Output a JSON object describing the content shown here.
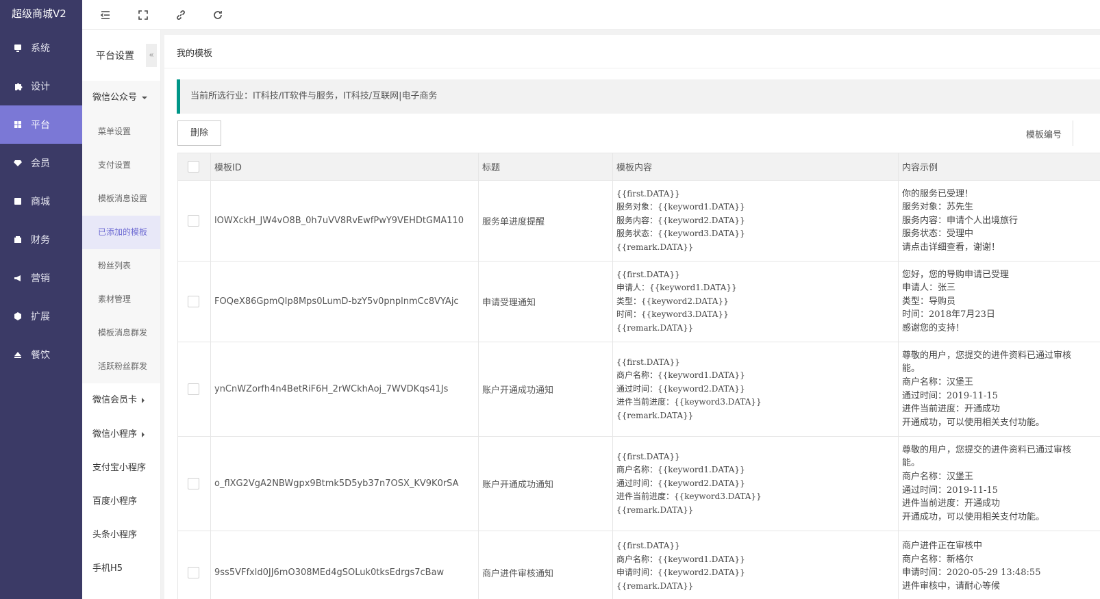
{
  "app": {
    "brand": "超级商城V2"
  },
  "nav": [
    {
      "label": "系统",
      "icon": "monitor-icon"
    },
    {
      "label": "设计",
      "icon": "puzzle-icon"
    },
    {
      "label": "平台",
      "icon": "grid-icon"
    },
    {
      "label": "会员",
      "icon": "diamond-icon"
    },
    {
      "label": "商城",
      "icon": "mail-icon"
    },
    {
      "label": "财务",
      "icon": "wallet-icon"
    },
    {
      "label": "营销",
      "icon": "megaphone-icon"
    },
    {
      "label": "扩展",
      "icon": "cube-icon"
    },
    {
      "label": "餐饮",
      "icon": "eject-icon"
    }
  ],
  "topbar": {
    "icons": [
      "menu-collapse-icon",
      "fullscreen-icon",
      "link-icon",
      "refresh-icon"
    ]
  },
  "subnav": {
    "title": "平台设置",
    "collapse": "«",
    "group_wechat": "微信公众号",
    "wechat_items": [
      "菜单设置",
      "支付设置",
      "模板消息设置",
      "已添加的模板",
      "粉丝列表",
      "素材管理",
      "模板消息群发",
      "活跃粉丝群发"
    ],
    "group_card": "微信会员卡",
    "group_mini": "微信小程序",
    "plain": [
      "支付宝小程序",
      "百度小程序",
      "头条小程序",
      "手机H5"
    ]
  },
  "main": {
    "breadcrumb": "我的模板",
    "notice": "当前所选行业：IT科技/IT软件与服务，IT科技/互联网|电子商务",
    "delete": "删除",
    "template_no_label": "模板编号"
  },
  "table": {
    "headers": [
      "模板ID",
      "标题",
      "模板内容",
      "内容示例"
    ],
    "rows": [
      {
        "id": "lOWXckH_JW4vO8B_0h7uVV8RvEwfPwY9VEHDtGMA110",
        "title": "服务单进度提醒",
        "content": "{{first.DATA}}\n服务对象：{{keyword1.DATA}}\n服务内容：{{keyword2.DATA}}\n服务状态：{{keyword3.DATA}}\n{{remark.DATA}}",
        "example": "你的服务已受理！\n服务对象：苏先生\n服务内容：申请个人出境旅行\n服务状态：受理中\n请点击详细查看，谢谢！"
      },
      {
        "id": "FOQeX86GpmQIp8Mps0LumD-bzY5v0pnplnmCc8VYAjc",
        "title": "申请受理通知",
        "content": "{{first.DATA}}\n申请人：{{keyword1.DATA}}\n类型：{{keyword2.DATA}}\n时间：{{keyword3.DATA}}\n{{remark.DATA}}",
        "example": "您好，您的导购申请已受理\n申请人：张三\n类型：导购员\n时间：2018年7月23日\n感谢您的支持！"
      },
      {
        "id": "ynCnWZorfh4n4BetRiF6H_2rWCkhAoj_7WVDKqs41Js",
        "title": "账户开通成功通知",
        "content": "{{first.DATA}}\n商户名称：{{keyword1.DATA}}\n通过时间：{{keyword2.DATA}}\n进件当前进度：{{keyword3.DATA}}\n{{remark.DATA}}",
        "example": "尊敬的用户，您提交的进件资料已通过审核\n能。\n商户名称：汉堡王\n通过时间：2019-11-15\n进件当前进度：开通成功\n开通成功，可以使用相关支付功能。"
      },
      {
        "id": "o_flXG2VgA2NBWgpx9Btmk5D5yb37n7OSX_KV9K0rSA",
        "title": "账户开通成功通知",
        "content": "{{first.DATA}}\n商户名称：{{keyword1.DATA}}\n通过时间：{{keyword2.DATA}}\n进件当前进度：{{keyword3.DATA}}\n{{remark.DATA}}",
        "example": "尊敬的用户，您提交的进件资料已通过审核\n能。\n商户名称：汉堡王\n通过时间：2019-11-15\n进件当前进度：开通成功\n开通成功，可以使用相关支付功能。"
      },
      {
        "id": "9ss5VFfxld0JJ6mO308MEd4gSOLuk0tksEdrgs7cBaw",
        "title": "商户进件审核通知",
        "content": "{{first.DATA}}\n商户名称：{{keyword1.DATA}}\n申请时间：{{keyword2.DATA}}\n{{remark.DATA}}",
        "example": "商户进件正在审核中\n商户名称：新格尔\n申请时间：2020-05-29 13:48:55\n进件审核中，请耐心等候"
      }
    ]
  }
}
